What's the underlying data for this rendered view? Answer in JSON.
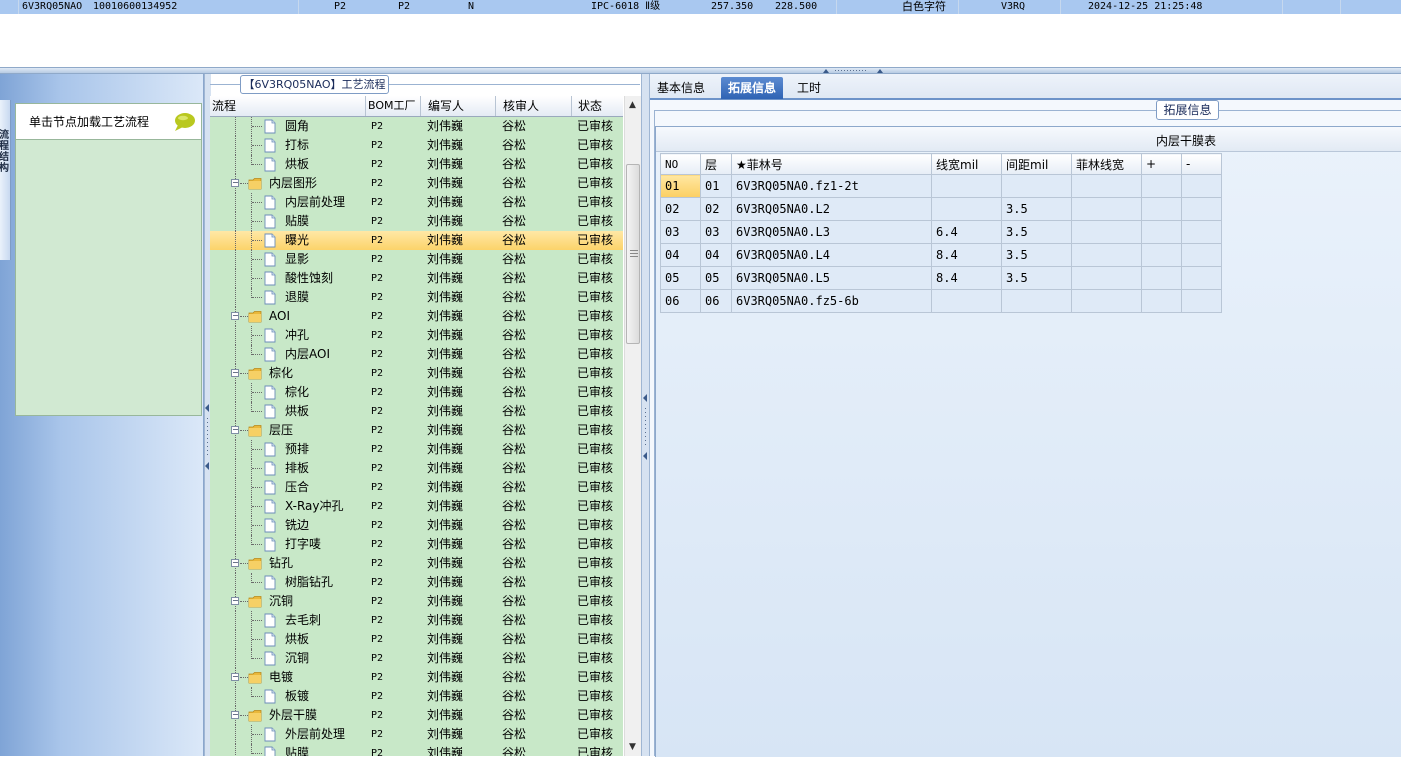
{
  "top_row": {
    "cells": [
      "6V3RQ05NAO",
      "10010600134952",
      "P2",
      "P2",
      "N",
      "IPC-6018 Ⅱ级",
      "257.350",
      "228.500",
      "白色字符",
      "V3RQ",
      "2024-12-25 21:25:48"
    ]
  },
  "left_panel": {
    "side_tab_label": "流程结构",
    "hint_text": "单击节点加载工艺流程",
    "hint_icon": "speech-bubble-icon"
  },
  "tree": {
    "title": "【6V3RQ05NAO】工艺流程",
    "columns": [
      "流程",
      "BOM工厂",
      "编写人",
      "核审人",
      "状态"
    ],
    "rows": [
      {
        "type": "leaf",
        "name": "圆角",
        "bom": "P2",
        "writer": "刘伟巍",
        "reviewer": "谷松",
        "status": "已审核"
      },
      {
        "type": "leaf",
        "name": "打标",
        "bom": "P2",
        "writer": "刘伟巍",
        "reviewer": "谷松",
        "status": "已审核"
      },
      {
        "type": "leaf",
        "name": "烘板",
        "bom": "P2",
        "writer": "刘伟巍",
        "reviewer": "谷松",
        "status": "已审核"
      },
      {
        "type": "folder",
        "name": "内层图形",
        "bom": "P2",
        "writer": "刘伟巍",
        "reviewer": "谷松",
        "status": "已审核"
      },
      {
        "type": "leaf",
        "name": "内层前处理",
        "bom": "P2",
        "writer": "刘伟巍",
        "reviewer": "谷松",
        "status": "已审核"
      },
      {
        "type": "leaf",
        "name": "贴膜",
        "bom": "P2",
        "writer": "刘伟巍",
        "reviewer": "谷松",
        "status": "已审核"
      },
      {
        "type": "leaf",
        "name": "曝光",
        "bom": "P2",
        "writer": "刘伟巍",
        "reviewer": "谷松",
        "status": "已审核",
        "selected": true
      },
      {
        "type": "leaf",
        "name": "显影",
        "bom": "P2",
        "writer": "刘伟巍",
        "reviewer": "谷松",
        "status": "已审核"
      },
      {
        "type": "leaf",
        "name": "酸性蚀刻",
        "bom": "P2",
        "writer": "刘伟巍",
        "reviewer": "谷松",
        "status": "已审核"
      },
      {
        "type": "leaf",
        "name": "退膜",
        "bom": "P2",
        "writer": "刘伟巍",
        "reviewer": "谷松",
        "status": "已审核"
      },
      {
        "type": "folder",
        "name": "AOI",
        "bom": "P2",
        "writer": "刘伟巍",
        "reviewer": "谷松",
        "status": "已审核"
      },
      {
        "type": "leaf",
        "name": "冲孔",
        "bom": "P2",
        "writer": "刘伟巍",
        "reviewer": "谷松",
        "status": "已审核"
      },
      {
        "type": "leaf",
        "name": "内层AOI",
        "bom": "P2",
        "writer": "刘伟巍",
        "reviewer": "谷松",
        "status": "已审核"
      },
      {
        "type": "folder",
        "name": "棕化",
        "bom": "P2",
        "writer": "刘伟巍",
        "reviewer": "谷松",
        "status": "已审核"
      },
      {
        "type": "leaf",
        "name": "棕化",
        "bom": "P2",
        "writer": "刘伟巍",
        "reviewer": "谷松",
        "status": "已审核"
      },
      {
        "type": "leaf",
        "name": "烘板",
        "bom": "P2",
        "writer": "刘伟巍",
        "reviewer": "谷松",
        "status": "已审核"
      },
      {
        "type": "folder",
        "name": "层压",
        "bom": "P2",
        "writer": "刘伟巍",
        "reviewer": "谷松",
        "status": "已审核"
      },
      {
        "type": "leaf",
        "name": "预排",
        "bom": "P2",
        "writer": "刘伟巍",
        "reviewer": "谷松",
        "status": "已审核"
      },
      {
        "type": "leaf",
        "name": "排板",
        "bom": "P2",
        "writer": "刘伟巍",
        "reviewer": "谷松",
        "status": "已审核"
      },
      {
        "type": "leaf",
        "name": "压合",
        "bom": "P2",
        "writer": "刘伟巍",
        "reviewer": "谷松",
        "status": "已审核"
      },
      {
        "type": "leaf",
        "name": "X-Ray冲孔",
        "bom": "P2",
        "writer": "刘伟巍",
        "reviewer": "谷松",
        "status": "已审核"
      },
      {
        "type": "leaf",
        "name": "铣边",
        "bom": "P2",
        "writer": "刘伟巍",
        "reviewer": "谷松",
        "status": "已审核"
      },
      {
        "type": "leaf",
        "name": "打字唛",
        "bom": "P2",
        "writer": "刘伟巍",
        "reviewer": "谷松",
        "status": "已审核"
      },
      {
        "type": "folder",
        "name": "钻孔",
        "bom": "P2",
        "writer": "刘伟巍",
        "reviewer": "谷松",
        "status": "已审核"
      },
      {
        "type": "leaf",
        "name": "树脂钻孔",
        "bom": "P2",
        "writer": "刘伟巍",
        "reviewer": "谷松",
        "status": "已审核"
      },
      {
        "type": "folder",
        "name": "沉铜",
        "bom": "P2",
        "writer": "刘伟巍",
        "reviewer": "谷松",
        "status": "已审核"
      },
      {
        "type": "leaf",
        "name": "去毛刺",
        "bom": "P2",
        "writer": "刘伟巍",
        "reviewer": "谷松",
        "status": "已审核"
      },
      {
        "type": "leaf",
        "name": "烘板",
        "bom": "P2",
        "writer": "刘伟巍",
        "reviewer": "谷松",
        "status": "已审核"
      },
      {
        "type": "leaf",
        "name": "沉铜",
        "bom": "P2",
        "writer": "刘伟巍",
        "reviewer": "谷松",
        "status": "已审核"
      },
      {
        "type": "folder",
        "name": "电镀",
        "bom": "P2",
        "writer": "刘伟巍",
        "reviewer": "谷松",
        "status": "已审核"
      },
      {
        "type": "leaf",
        "name": "板镀",
        "bom": "P2",
        "writer": "刘伟巍",
        "reviewer": "谷松",
        "status": "已审核"
      },
      {
        "type": "folder",
        "name": "外层干膜",
        "bom": "P2",
        "writer": "刘伟巍",
        "reviewer": "谷松",
        "status": "已审核"
      },
      {
        "type": "leaf",
        "name": "外层前处理",
        "bom": "P2",
        "writer": "刘伟巍",
        "reviewer": "谷松",
        "status": "已审核"
      },
      {
        "type": "leaf",
        "name": "贴膜",
        "bom": "P2",
        "writer": "刘伟巍",
        "reviewer": "谷松",
        "status": "已审核"
      }
    ]
  },
  "right_panel": {
    "tabs": [
      {
        "label": "基本信息",
        "active": false
      },
      {
        "label": "拓展信息",
        "active": true
      },
      {
        "label": "工时",
        "active": false
      }
    ],
    "group_label": "拓展信息",
    "table_title": "内层干膜表",
    "columns": [
      "NO",
      "层",
      "★菲林号",
      "线宽mil",
      "间距mil",
      "菲林线宽",
      "+",
      "-"
    ],
    "rows": [
      {
        "no": "01",
        "layer": "01",
        "film": "6V3RQ05NA0.fz1-2t",
        "width": "",
        "spacing": "",
        "film_width": "",
        "plus": "",
        "minus": "",
        "selected": true
      },
      {
        "no": "02",
        "layer": "02",
        "film": "6V3RQ05NA0.L2",
        "width": "",
        "spacing": "3.5",
        "film_width": "",
        "plus": "",
        "minus": ""
      },
      {
        "no": "03",
        "layer": "03",
        "film": "6V3RQ05NA0.L3",
        "width": "6.4",
        "spacing": "3.5",
        "film_width": "",
        "plus": "",
        "minus": ""
      },
      {
        "no": "04",
        "layer": "04",
        "film": "6V3RQ05NA0.L4",
        "width": "8.4",
        "spacing": "3.5",
        "film_width": "",
        "plus": "",
        "minus": ""
      },
      {
        "no": "05",
        "layer": "05",
        "film": "6V3RQ05NA0.L5",
        "width": "8.4",
        "spacing": "3.5",
        "film_width": "",
        "plus": "",
        "minus": ""
      },
      {
        "no": "06",
        "layer": "06",
        "film": "6V3RQ05NA0.fz5-6b",
        "width": "",
        "spacing": "",
        "film_width": "",
        "plus": "",
        "minus": ""
      }
    ]
  },
  "colors": {
    "tree_background": "#c8e8c8",
    "selection": "#fcd36a",
    "tab_active": "#2f63b4",
    "top_row": "#a9c8f0"
  }
}
